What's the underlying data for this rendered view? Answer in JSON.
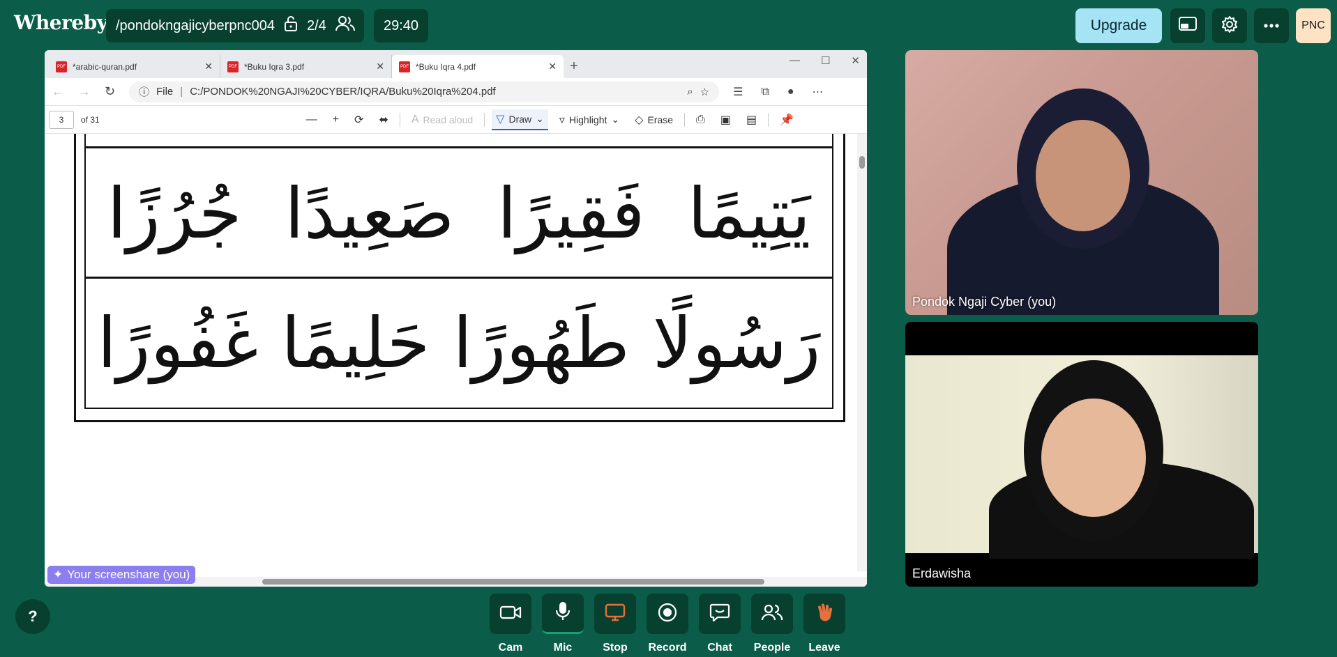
{
  "app": {
    "logo": "Whereby"
  },
  "room": {
    "name": "/pondokngajicyberpnc004",
    "participants": "2/4",
    "timer": "29:40"
  },
  "header": {
    "upgrade_label": "Upgrade",
    "avatar_initials": "PNC"
  },
  "screenshare": {
    "label": "Your screenshare (you)",
    "browser": {
      "tabs": [
        {
          "label": "*arabic-quran.pdf",
          "active": false
        },
        {
          "label": "*Buku Iqra 3.pdf",
          "active": false
        },
        {
          "label": "*Buku Iqra 4.pdf",
          "active": true
        }
      ],
      "file_label": "File",
      "url": "C:/PONDOK%20NGAJI%20CYBER/IQRA/Buku%20Iqra%204.pdf",
      "pdf_toolbar": {
        "page": "3",
        "of_pages": "of 31",
        "read_aloud": "Read aloud",
        "draw": "Draw",
        "highlight": "Highlight",
        "erase": "Erase"
      }
    },
    "arabic_rows": [
      [
        "يَتِيمًا",
        "فَقِيرًا",
        "صَعِيدًا",
        "جُرُزًا"
      ],
      [
        "رَسُولًا",
        "طَهُورًا",
        "حَلِيمًا",
        "غَفُورًا"
      ]
    ]
  },
  "participants": [
    {
      "name": "Pondok Ngaji Cyber (you)"
    },
    {
      "name": "Erdawisha"
    }
  ],
  "controls": [
    {
      "label": "Cam",
      "icon": "camera-icon"
    },
    {
      "label": "Mic",
      "icon": "microphone-icon"
    },
    {
      "label": "Stop",
      "icon": "screenshare-icon",
      "color": "#e8703a"
    },
    {
      "label": "Record",
      "icon": "record-icon"
    },
    {
      "label": "Chat",
      "icon": "chat-icon"
    },
    {
      "label": "People",
      "icon": "people-icon"
    },
    {
      "label": "Leave",
      "icon": "wave-hand-icon",
      "color": "#e8703a"
    }
  ],
  "help_label": "?"
}
